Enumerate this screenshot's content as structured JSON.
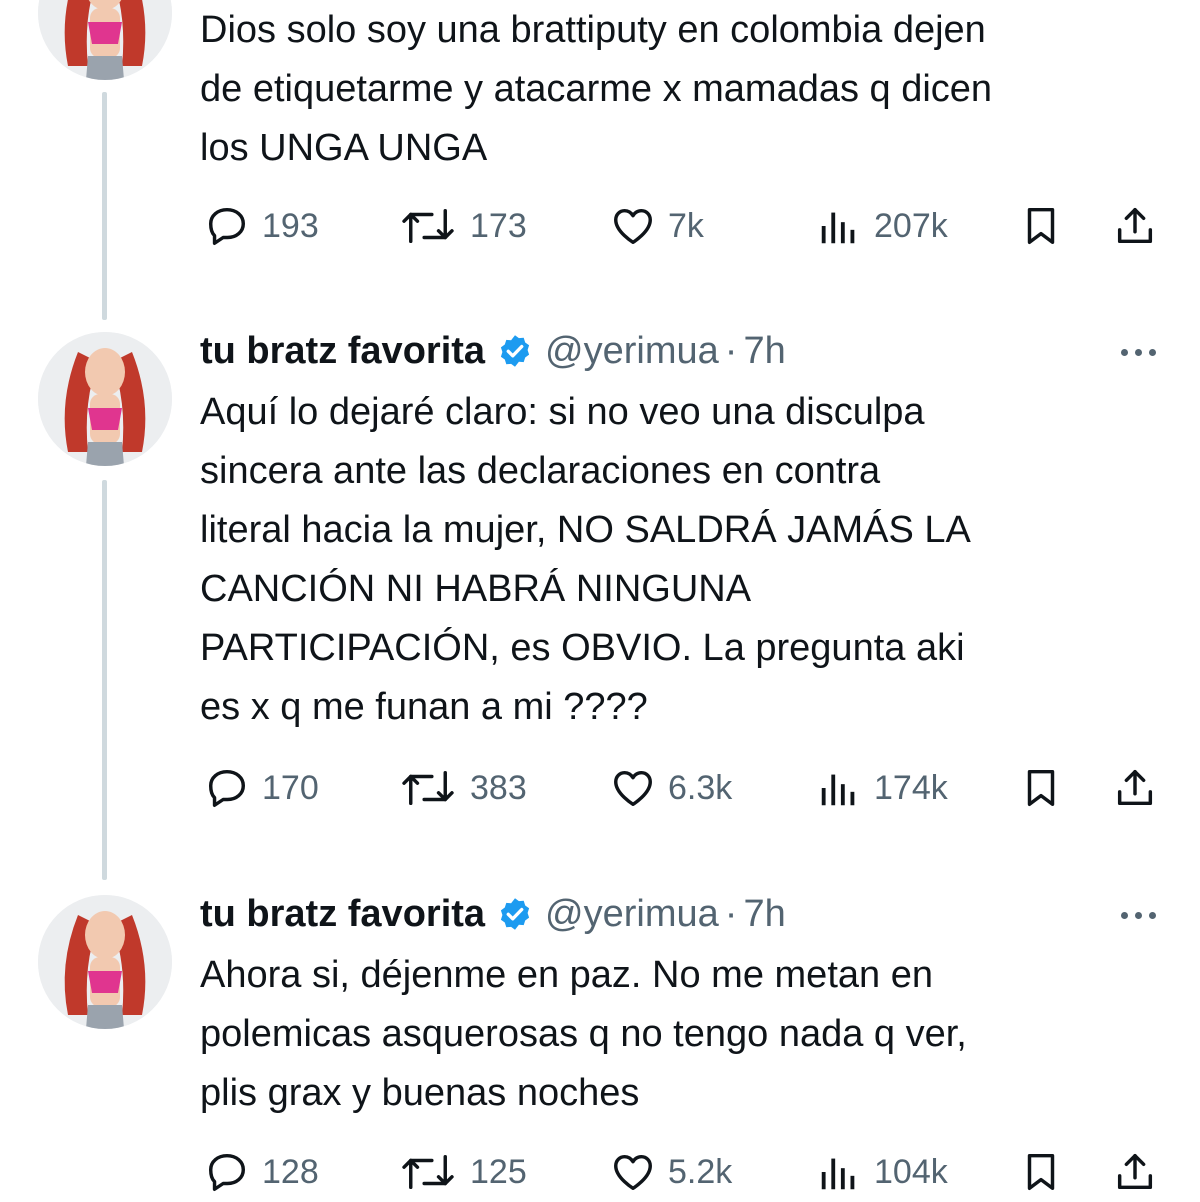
{
  "tweets": [
    {
      "text_lines": [
        "Dios solo soy una brattiputy en colombia dejen",
        "de etiquetarme y atacarme x mamadas q dicen",
        "los UNGA UNGA"
      ],
      "replies": "193",
      "retweets": "173",
      "likes": "7k",
      "views": "207k"
    },
    {
      "name": "tu bratz favorita",
      "handle": "@yerimua",
      "separator": "·",
      "time": "7h",
      "text_lines": [
        "Aquí lo dejaré claro: si no veo una disculpa",
        "sincera ante las declaraciones en contra",
        "literal hacia la mujer, NO SALDRÁ JAMÁS LA",
        "CANCIÓN NI HABRÁ NINGUNA",
        "PARTICIPACIÓN, es OBVIO. La pregunta aki",
        "es x q me funan a mi ????"
      ],
      "replies": "170",
      "retweets": "383",
      "likes": "6.3k",
      "views": "174k"
    },
    {
      "name": "tu bratz favorita",
      "handle": "@yerimua",
      "separator": "·",
      "time": "7h",
      "text_lines": [
        "Ahora si, déjenme en paz. No me metan en",
        "polemicas asquerosas q no tengo nada q ver,",
        "plis grax y buenas noches"
      ],
      "replies": "128",
      "retweets": "125",
      "likes": "5.2k",
      "views": "104k"
    }
  ],
  "icons": {
    "reply": "reply-icon",
    "retweet": "retweet-icon",
    "like": "heart-icon",
    "views": "views-icon",
    "bookmark": "bookmark-icon",
    "share": "share-icon",
    "verified": "verified-badge-icon",
    "more": "more-icon"
  },
  "colors": {
    "verified": "#1d9bf0",
    "text": "#0f1419",
    "secondary": "#536471",
    "thread_line": "#cfd9de"
  }
}
